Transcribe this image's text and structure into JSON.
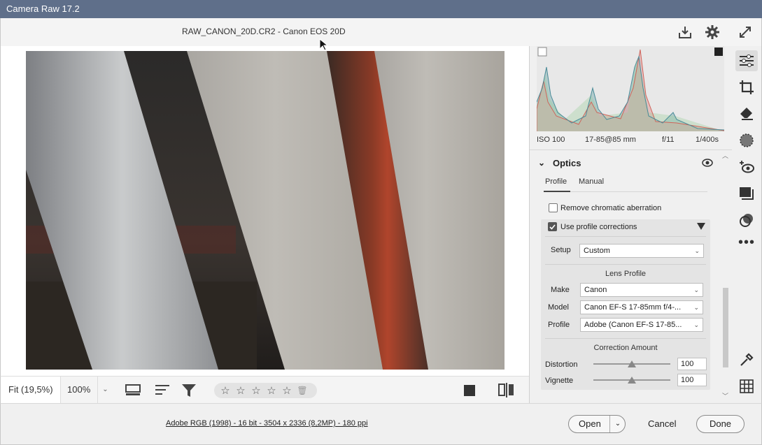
{
  "window": {
    "title": "Camera Raw 17.2"
  },
  "header": {
    "filename": "RAW_CANON_20D.CR2  -  Canon EOS 20D",
    "icons": [
      "save-icon",
      "gear-icon",
      "fullscreen-icon"
    ]
  },
  "viewer_bar": {
    "zoom_fit": "Fit (19,5%)",
    "zoom_100": "100%",
    "stars": [
      "☆",
      "☆",
      "☆",
      "☆",
      "☆"
    ],
    "trash": "🗑"
  },
  "footer": {
    "info": "Adobe RGB (1998) - 16 bit - 3504 x 2336 (8,2MP) - 180 ppi",
    "open": "Open",
    "cancel": "Cancel",
    "done": "Done"
  },
  "exif": {
    "iso": "ISO 100",
    "focal": "17-85@85 mm",
    "aperture": "f/11",
    "shutter": "1/400s"
  },
  "optics": {
    "title": "Optics",
    "tabs": [
      "Profile",
      "Manual"
    ],
    "remove_ca": "Remove chromatic aberration",
    "use_profile": "Use profile corrections",
    "setup_label": "Setup",
    "setup_value": "Custom",
    "lens_profile": "Lens Profile",
    "make_label": "Make",
    "make_value": "Canon",
    "model_label": "Model",
    "model_value": "Canon EF-S 17-85mm f/4-...",
    "profile_label": "Profile",
    "profile_value": "Adobe (Canon EF-S 17-85...",
    "correction_amount": "Correction Amount",
    "distortion_label": "Distortion",
    "distortion_value": "100",
    "vignette_label": "Vignette",
    "vignette_value": "100"
  },
  "colors": {
    "titlebar": "#5f6f8a",
    "panel": "#f0f0f0",
    "subpanel": "#e4e4e4"
  }
}
